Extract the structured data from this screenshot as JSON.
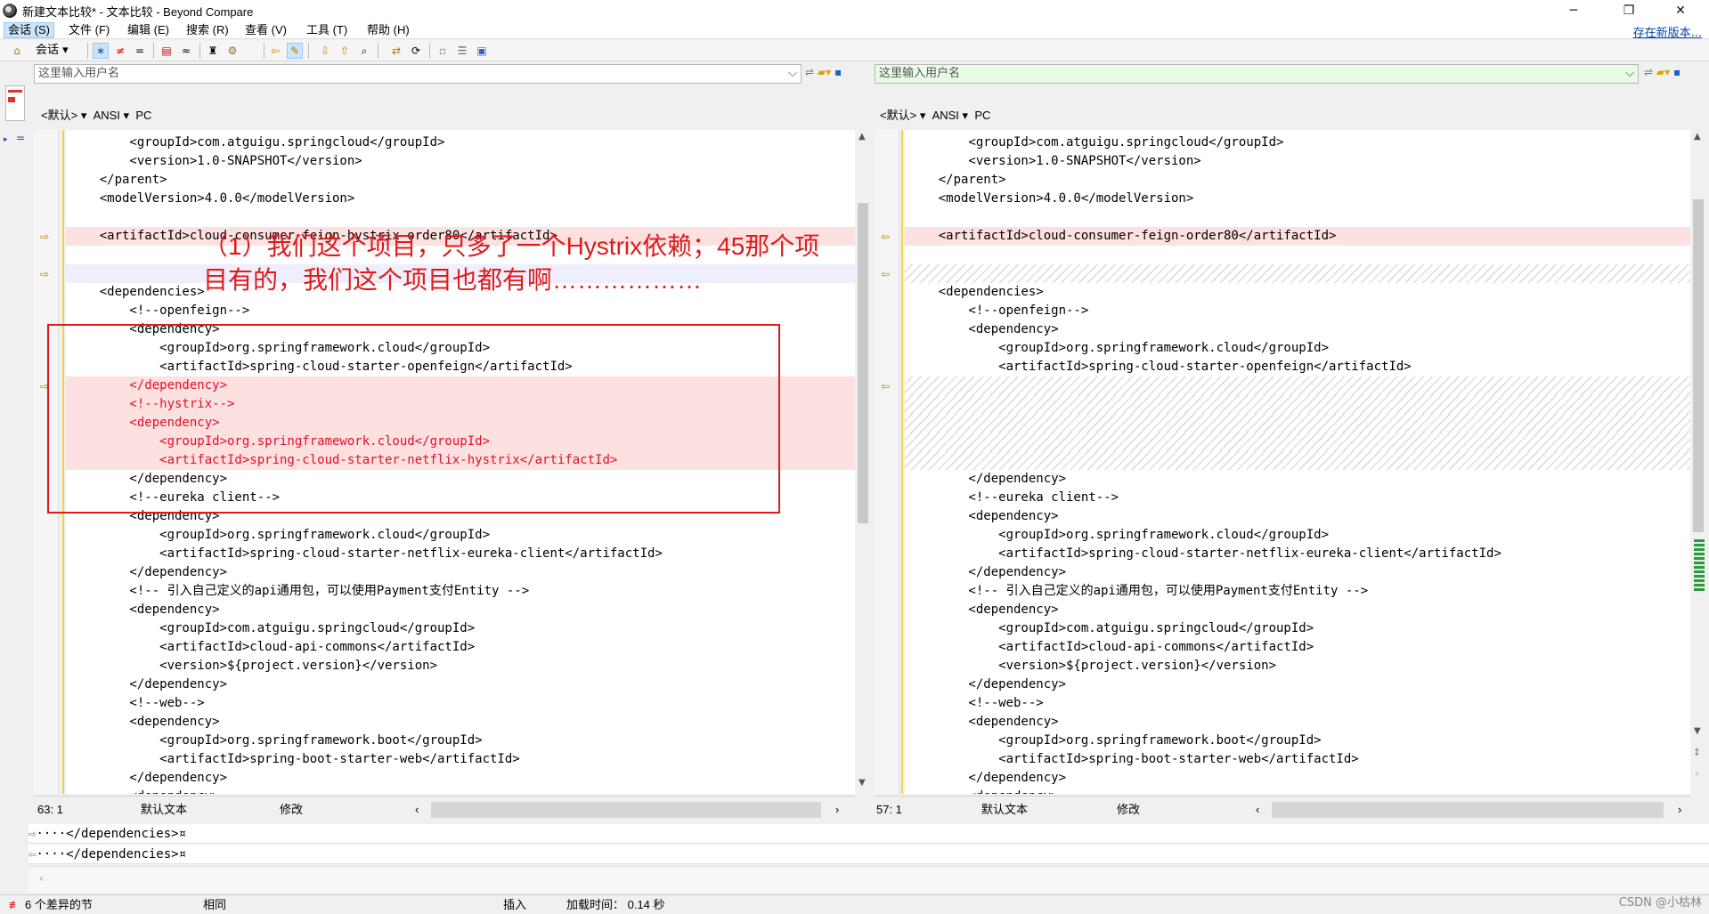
{
  "window": {
    "title": "新建文本比较* - 文本比较 - Beyond Compare",
    "minimize": "─",
    "restore": "❐",
    "close": "✕"
  },
  "menu": {
    "items": [
      "会话 (S)",
      "文件 (F)",
      "编辑 (E)",
      "搜索 (R)",
      "查看 (V)",
      "工具 (T)",
      "帮助 (H)"
    ],
    "new_version_link": "存在新版本..."
  },
  "toolbar": {
    "session_label": "会话"
  },
  "left": {
    "path_placeholder": "这里输入用户名",
    "format": {
      "preset": "<默认>",
      "encoding": "ANSI",
      "line_ending": "PC"
    },
    "status": {
      "position": "63: 1",
      "format": "默认文本",
      "state": "修改"
    },
    "lines": [
      {
        "text": "        <groupId>com.atguigu.springcloud</groupId>",
        "kind": "same"
      },
      {
        "text": "        <version>1.0-SNAPSHOT</version>",
        "kind": "same"
      },
      {
        "text": "    </parent>",
        "kind": "same"
      },
      {
        "text": "    <modelVersion>4.0.0</modelVersion>",
        "kind": "same"
      },
      {
        "text": "",
        "kind": "same"
      },
      {
        "text": "    <artifactId>cloud-consumer-feign-hystrix-order80</artifactId>",
        "kind": "diff"
      },
      {
        "text": "",
        "kind": "same"
      },
      {
        "text": "",
        "kind": "lav"
      },
      {
        "text": "    <dependencies>",
        "kind": "same"
      },
      {
        "text": "        <!--openfeign-->",
        "kind": "same"
      },
      {
        "text": "        <dependency>",
        "kind": "same"
      },
      {
        "text": "            <groupId>org.springframework.cloud</groupId>",
        "kind": "same"
      },
      {
        "text": "            <artifactId>spring-cloud-starter-openfeign</artifactId>",
        "kind": "same"
      },
      {
        "text": "        </dependency>",
        "kind": "diffred"
      },
      {
        "text": "        <!--hystrix-->",
        "kind": "diffred"
      },
      {
        "text": "        <dependency>",
        "kind": "diffred"
      },
      {
        "text": "            <groupId>org.springframework.cloud</groupId>",
        "kind": "diffred"
      },
      {
        "text": "            <artifactId>spring-cloud-starter-netflix-hystrix</artifactId>",
        "kind": "diffred"
      },
      {
        "text": "        </dependency>",
        "kind": "same"
      },
      {
        "text": "        <!--eureka client-->",
        "kind": "same"
      },
      {
        "text": "        <dependency>",
        "kind": "same"
      },
      {
        "text": "            <groupId>org.springframework.cloud</groupId>",
        "kind": "same"
      },
      {
        "text": "            <artifactId>spring-cloud-starter-netflix-eureka-client</artifactId>",
        "kind": "same"
      },
      {
        "text": "        </dependency>",
        "kind": "same"
      },
      {
        "text": "        <!-- 引入自己定义的api通用包，可以使用Payment支付Entity -->",
        "kind": "same"
      },
      {
        "text": "        <dependency>",
        "kind": "same"
      },
      {
        "text": "            <groupId>com.atguigu.springcloud</groupId>",
        "kind": "same"
      },
      {
        "text": "            <artifactId>cloud-api-commons</artifactId>",
        "kind": "same"
      },
      {
        "text": "            <version>${project.version}</version>",
        "kind": "same"
      },
      {
        "text": "        </dependency>",
        "kind": "same"
      },
      {
        "text": "        <!--web-->",
        "kind": "same"
      },
      {
        "text": "        <dependency>",
        "kind": "same"
      },
      {
        "text": "            <groupId>org.springframework.boot</groupId>",
        "kind": "same"
      },
      {
        "text": "            <artifactId>spring-boot-starter-web</artifactId>",
        "kind": "same"
      },
      {
        "text": "        </dependency>",
        "kind": "same"
      },
      {
        "text": "        <dependency>",
        "kind": "same"
      }
    ]
  },
  "right": {
    "path_placeholder": "这里输入用户名",
    "format": {
      "preset": "<默认>",
      "encoding": "ANSI",
      "line_ending": "PC"
    },
    "status": {
      "position": "57: 1",
      "format": "默认文本",
      "state": "修改"
    },
    "lines": [
      {
        "text": "        <groupId>com.atguigu.springcloud</groupId>",
        "kind": "same"
      },
      {
        "text": "        <version>1.0-SNAPSHOT</version>",
        "kind": "same"
      },
      {
        "text": "    </parent>",
        "kind": "same"
      },
      {
        "text": "    <modelVersion>4.0.0</modelVersion>",
        "kind": "same"
      },
      {
        "text": "",
        "kind": "same"
      },
      {
        "text": "    <artifactId>cloud-consumer-feign-order80</artifactId>",
        "kind": "diff"
      },
      {
        "text": "",
        "kind": "same"
      },
      {
        "text": "",
        "kind": "hatch"
      },
      {
        "text": "    <dependencies>",
        "kind": "same"
      },
      {
        "text": "        <!--openfeign-->",
        "kind": "same"
      },
      {
        "text": "        <dependency>",
        "kind": "same"
      },
      {
        "text": "            <groupId>org.springframework.cloud</groupId>",
        "kind": "same"
      },
      {
        "text": "            <artifactId>spring-cloud-starter-openfeign</artifactId>",
        "kind": "same"
      },
      {
        "text": "",
        "kind": "hatch"
      },
      {
        "text": "",
        "kind": "hatch"
      },
      {
        "text": "",
        "kind": "hatch"
      },
      {
        "text": "",
        "kind": "hatch"
      },
      {
        "text": "",
        "kind": "hatch"
      },
      {
        "text": "        </dependency>",
        "kind": "same"
      },
      {
        "text": "        <!--eureka client-->",
        "kind": "same"
      },
      {
        "text": "        <dependency>",
        "kind": "same"
      },
      {
        "text": "            <groupId>org.springframework.cloud</groupId>",
        "kind": "same"
      },
      {
        "text": "            <artifactId>spring-cloud-starter-netflix-eureka-client</artifactId>",
        "kind": "same"
      },
      {
        "text": "        </dependency>",
        "kind": "same"
      },
      {
        "text": "        <!-- 引入自己定义的api通用包，可以使用Payment支付Entity -->",
        "kind": "same"
      },
      {
        "text": "        <dependency>",
        "kind": "same"
      },
      {
        "text": "            <groupId>com.atguigu.springcloud</groupId>",
        "kind": "same"
      },
      {
        "text": "            <artifactId>cloud-api-commons</artifactId>",
        "kind": "same"
      },
      {
        "text": "            <version>${project.version}</version>",
        "kind": "same"
      },
      {
        "text": "        </dependency>",
        "kind": "same"
      },
      {
        "text": "        <!--web-->",
        "kind": "same"
      },
      {
        "text": "        <dependency>",
        "kind": "same"
      },
      {
        "text": "            <groupId>org.springframework.boot</groupId>",
        "kind": "same"
      },
      {
        "text": "            <artifactId>spring-boot-starter-web</artifactId>",
        "kind": "same"
      },
      {
        "text": "        </dependency>",
        "kind": "same"
      },
      {
        "text": "        <dependency>",
        "kind": "same"
      }
    ]
  },
  "bottom_lines": {
    "left": "····</dependencies>¤",
    "right": "····</dependencies>¤"
  },
  "statusbar": {
    "diff_count": "6 个差异的节",
    "same": "相同",
    "insert": "插入",
    "load_time": "加载时间： 0.14 秒"
  },
  "annotation": {
    "text": "（1）我们这个项目，只多了一个Hystrix依赖；45那个项\n目有的，我们这个项目也都有啊………………"
  },
  "watermark": "CSDN @小枯林",
  "colors": {
    "diff_bg": "#fde0e0",
    "diff_text": "#e0102a",
    "annotation": "#e01a1a",
    "marker": "#c48400"
  }
}
